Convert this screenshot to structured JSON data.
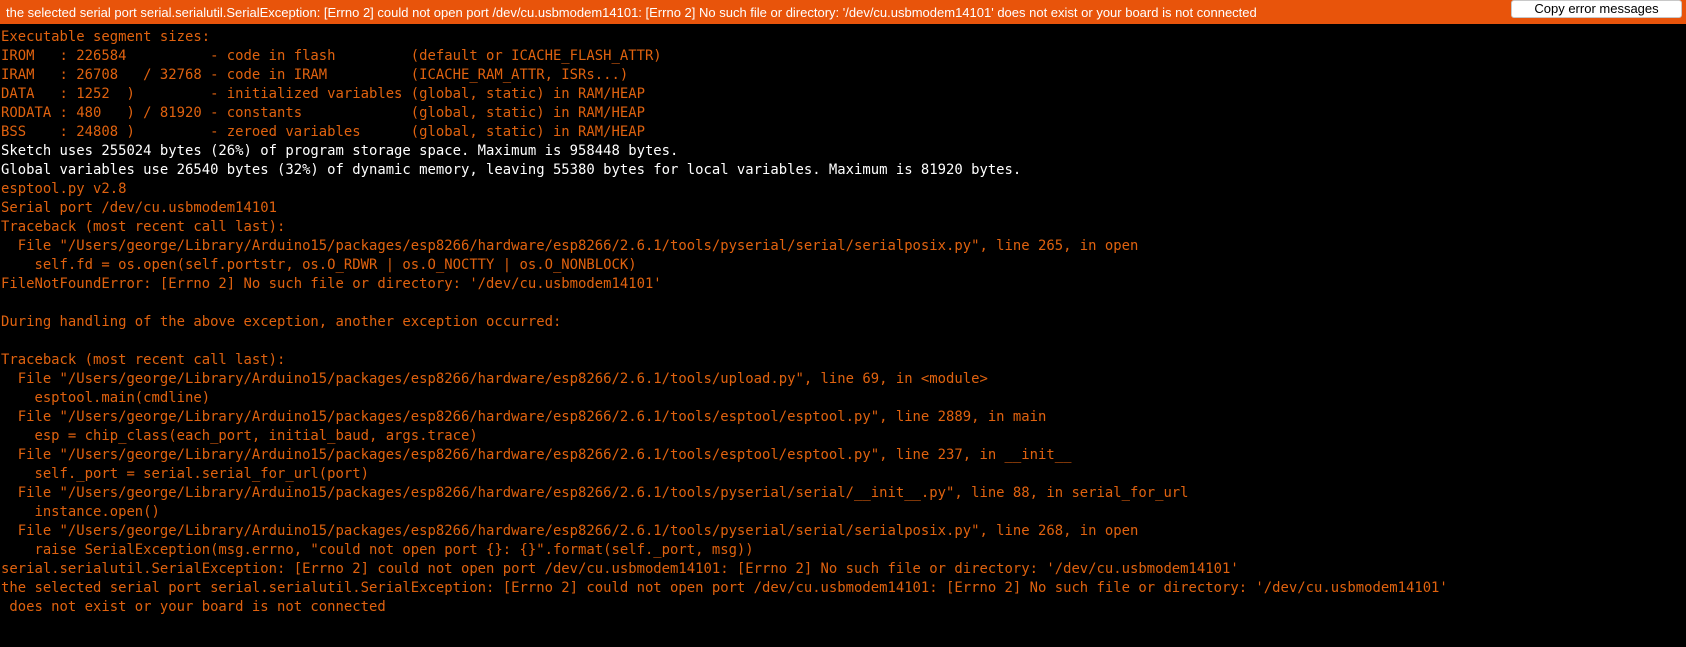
{
  "error_bar": {
    "message": "the selected serial port serial.serialutil.SerialException: [Errno 2] could not open port /dev/cu.usbmodem14101: [Errno 2] No such file or directory: '/dev/cu.usbmodem14101'  does not exist or your board is not connected",
    "copy_button_label": "Copy error messages",
    "background_color": "#e8540b"
  },
  "console": {
    "colors": {
      "error_text": "#e0620f",
      "normal_text": "#ffffff",
      "background": "#000000"
    },
    "lines": [
      {
        "text": "Executable segment sizes:",
        "kind": "err"
      },
      {
        "text": "IROM   : 226584          - code in flash         (default or ICACHE_FLASH_ATTR)",
        "kind": "err"
      },
      {
        "text": "IRAM   : 26708   / 32768 - code in IRAM          (ICACHE_RAM_ATTR, ISRs...)",
        "kind": "err"
      },
      {
        "text": "DATA   : 1252  )         - initialized variables (global, static) in RAM/HEAP",
        "kind": "err"
      },
      {
        "text": "RODATA : 480   ) / 81920 - constants             (global, static) in RAM/HEAP",
        "kind": "err"
      },
      {
        "text": "BSS    : 24808 )         - zeroed variables      (global, static) in RAM/HEAP",
        "kind": "err"
      },
      {
        "text": "Sketch uses 255024 bytes (26%) of program storage space. Maximum is 958448 bytes.",
        "kind": "out"
      },
      {
        "text": "Global variables use 26540 bytes (32%) of dynamic memory, leaving 55380 bytes for local variables. Maximum is 81920 bytes.",
        "kind": "out"
      },
      {
        "text": "esptool.py v2.8",
        "kind": "err"
      },
      {
        "text": "Serial port /dev/cu.usbmodem14101",
        "kind": "err"
      },
      {
        "text": "Traceback (most recent call last):",
        "kind": "err"
      },
      {
        "text": "  File \"/Users/george/Library/Arduino15/packages/esp8266/hardware/esp8266/2.6.1/tools/pyserial/serial/serialposix.py\", line 265, in open",
        "kind": "err"
      },
      {
        "text": "    self.fd = os.open(self.portstr, os.O_RDWR | os.O_NOCTTY | os.O_NONBLOCK)",
        "kind": "err"
      },
      {
        "text": "FileNotFoundError: [Errno 2] No such file or directory: '/dev/cu.usbmodem14101'",
        "kind": "err"
      },
      {
        "text": "",
        "kind": "err"
      },
      {
        "text": "During handling of the above exception, another exception occurred:",
        "kind": "err"
      },
      {
        "text": "",
        "kind": "err"
      },
      {
        "text": "Traceback (most recent call last):",
        "kind": "err"
      },
      {
        "text": "  File \"/Users/george/Library/Arduino15/packages/esp8266/hardware/esp8266/2.6.1/tools/upload.py\", line 69, in <module>",
        "kind": "err"
      },
      {
        "text": "    esptool.main(cmdline)",
        "kind": "err"
      },
      {
        "text": "  File \"/Users/george/Library/Arduino15/packages/esp8266/hardware/esp8266/2.6.1/tools/esptool/esptool.py\", line 2889, in main",
        "kind": "err"
      },
      {
        "text": "    esp = chip_class(each_port, initial_baud, args.trace)",
        "kind": "err"
      },
      {
        "text": "  File \"/Users/george/Library/Arduino15/packages/esp8266/hardware/esp8266/2.6.1/tools/esptool/esptool.py\", line 237, in __init__",
        "kind": "err"
      },
      {
        "text": "    self._port = serial.serial_for_url(port)",
        "kind": "err"
      },
      {
        "text": "  File \"/Users/george/Library/Arduino15/packages/esp8266/hardware/esp8266/2.6.1/tools/pyserial/serial/__init__.py\", line 88, in serial_for_url",
        "kind": "err"
      },
      {
        "text": "    instance.open()",
        "kind": "err"
      },
      {
        "text": "  File \"/Users/george/Library/Arduino15/packages/esp8266/hardware/esp8266/2.6.1/tools/pyserial/serial/serialposix.py\", line 268, in open",
        "kind": "err"
      },
      {
        "text": "    raise SerialException(msg.errno, \"could not open port {}: {}\".format(self._port, msg))",
        "kind": "err"
      },
      {
        "text": "serial.serialutil.SerialException: [Errno 2] could not open port /dev/cu.usbmodem14101: [Errno 2] No such file or directory: '/dev/cu.usbmodem14101'",
        "kind": "err"
      },
      {
        "text": "the selected serial port serial.serialutil.SerialException: [Errno 2] could not open port /dev/cu.usbmodem14101: [Errno 2] No such file or directory: '/dev/cu.usbmodem14101'",
        "kind": "err"
      },
      {
        "text": " does not exist or your board is not connected",
        "kind": "err"
      }
    ]
  }
}
